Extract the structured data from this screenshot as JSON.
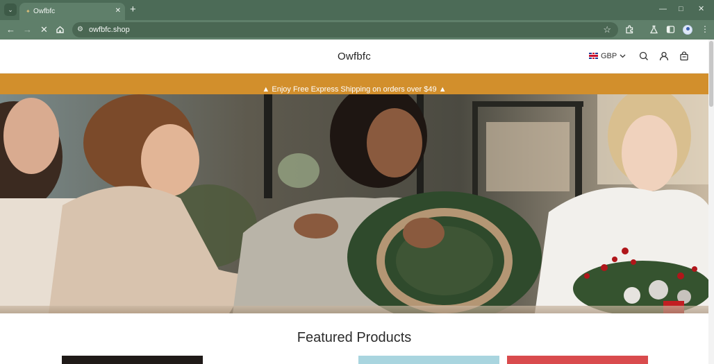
{
  "browser": {
    "tab": {
      "title": "Owfbfc",
      "favicon": "loading-favicon-icon"
    },
    "address": {
      "url": "owfbfc.shop"
    },
    "icons": [
      "back-icon",
      "forward-icon",
      "stop-icon",
      "home-icon",
      "site-info-icon",
      "bookmark-star-icon",
      "extensions-icon",
      "labs-icon",
      "sidebar-icon",
      "profile-icon",
      "kebab-menu-icon"
    ]
  },
  "store": {
    "logo": "Owfbfc",
    "currency": "GBP",
    "announcement": "Enjoy Free Express Shipping on orders over $49",
    "featured_title": "Featured Products",
    "hero_alt_colors": {
      "background": "#6b5a47",
      "wreath_green": "#2f4a2c",
      "berry_red": "#b0161a"
    }
  },
  "colors": {
    "tabbar": "#4c6b57",
    "toolbar": "#5f7f6a",
    "announcement_bar": "#d28f2c"
  }
}
